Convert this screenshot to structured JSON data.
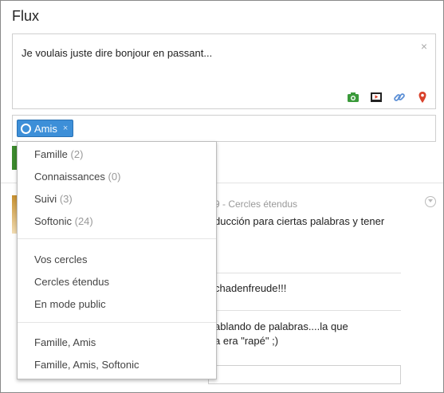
{
  "page": {
    "title": "Flux"
  },
  "composer": {
    "text": "Je voulais juste dire bonjour en passant...",
    "close_glyph": "×",
    "icons": [
      "camera-icon",
      "video-icon",
      "link-icon",
      "location-pin-icon"
    ]
  },
  "share": {
    "chip_label": "Amis",
    "chip_remove": "×"
  },
  "dropdown": {
    "groups": [
      {
        "items": [
          {
            "label": "Famille",
            "count": "(2)"
          },
          {
            "label": "Connaissances",
            "count": "(0)"
          },
          {
            "label": "Suivi",
            "count": "(3)"
          },
          {
            "label": "Softonic",
            "count": "(24)"
          }
        ]
      },
      {
        "items": [
          {
            "label": "Vos cercles"
          },
          {
            "label": "Cercles étendus"
          },
          {
            "label": "En mode public"
          }
        ]
      },
      {
        "items": [
          {
            "label": "Famille, Amis"
          },
          {
            "label": "Famille, Amis, Softonic"
          }
        ]
      }
    ]
  },
  "post": {
    "meta": "9  -  Cercles étendus",
    "line1": "ducción para ciertas palabras y tener",
    "comment1": "chadenfreude!!!",
    "comment2_line1": "ablando de palabras....la que",
    "comment2_line2": "a era \"rapé\" ;)"
  },
  "colors": {
    "chip": "#3d8fd8",
    "camera": "#3a9a3a",
    "video": "#222222",
    "link": "#5b8fd6",
    "pin": "#d9412b"
  }
}
